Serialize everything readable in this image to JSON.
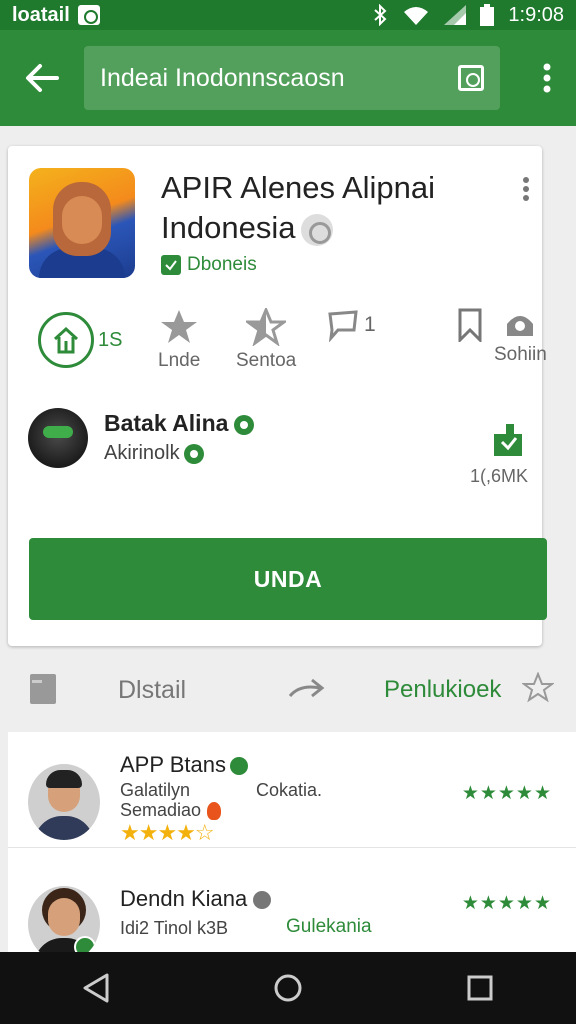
{
  "status_bar": {
    "carrier": "loatail",
    "time": "1:9:08"
  },
  "app_bar": {
    "search_text": "Indeai Inodonnscaosn"
  },
  "app": {
    "title": "APIR Alenes Alipnai Indonesia",
    "developer": "Dboneis",
    "install_count": "1S"
  },
  "stats": [
    {
      "label": "Lnde"
    },
    {
      "label": "Sentoa"
    },
    {
      "label": "1"
    },
    {
      "label": ""
    },
    {
      "label": "Sohiin"
    }
  ],
  "top_reviewer": {
    "name": "Batak Alina",
    "subtitle": "Akirinolk",
    "size": "1(,6MK"
  },
  "install_button": {
    "label": "UNDA"
  },
  "tabs": {
    "detail": "Dlstail",
    "reviews": "Penlukioek"
  },
  "reviews": [
    {
      "name": "APP Btans",
      "line1": "Galatilyn",
      "line2": "Semadiao",
      "tag": "Cokatia.",
      "stars_right": "★★★★★",
      "stars_gold": "★★★★☆"
    },
    {
      "name": "Dendn Kiana",
      "line1": "Idi2 Tinol k3B",
      "tag": "Gulekania",
      "stars_right": "★★★★★"
    }
  ],
  "colors": {
    "primary": "#2e8b3a",
    "status_bar": "#1f7a2e",
    "star_gold": "#f3b10e"
  },
  "icons": [
    "back-arrow-icon",
    "qr-icon",
    "more-vert-icon",
    "star-icon",
    "star-half-icon",
    "comment-icon",
    "bookmark-icon",
    "share-icon",
    "download-icon",
    "arrow-right-icon",
    "nav-back-icon",
    "nav-home-icon",
    "nav-recents-icon"
  ]
}
